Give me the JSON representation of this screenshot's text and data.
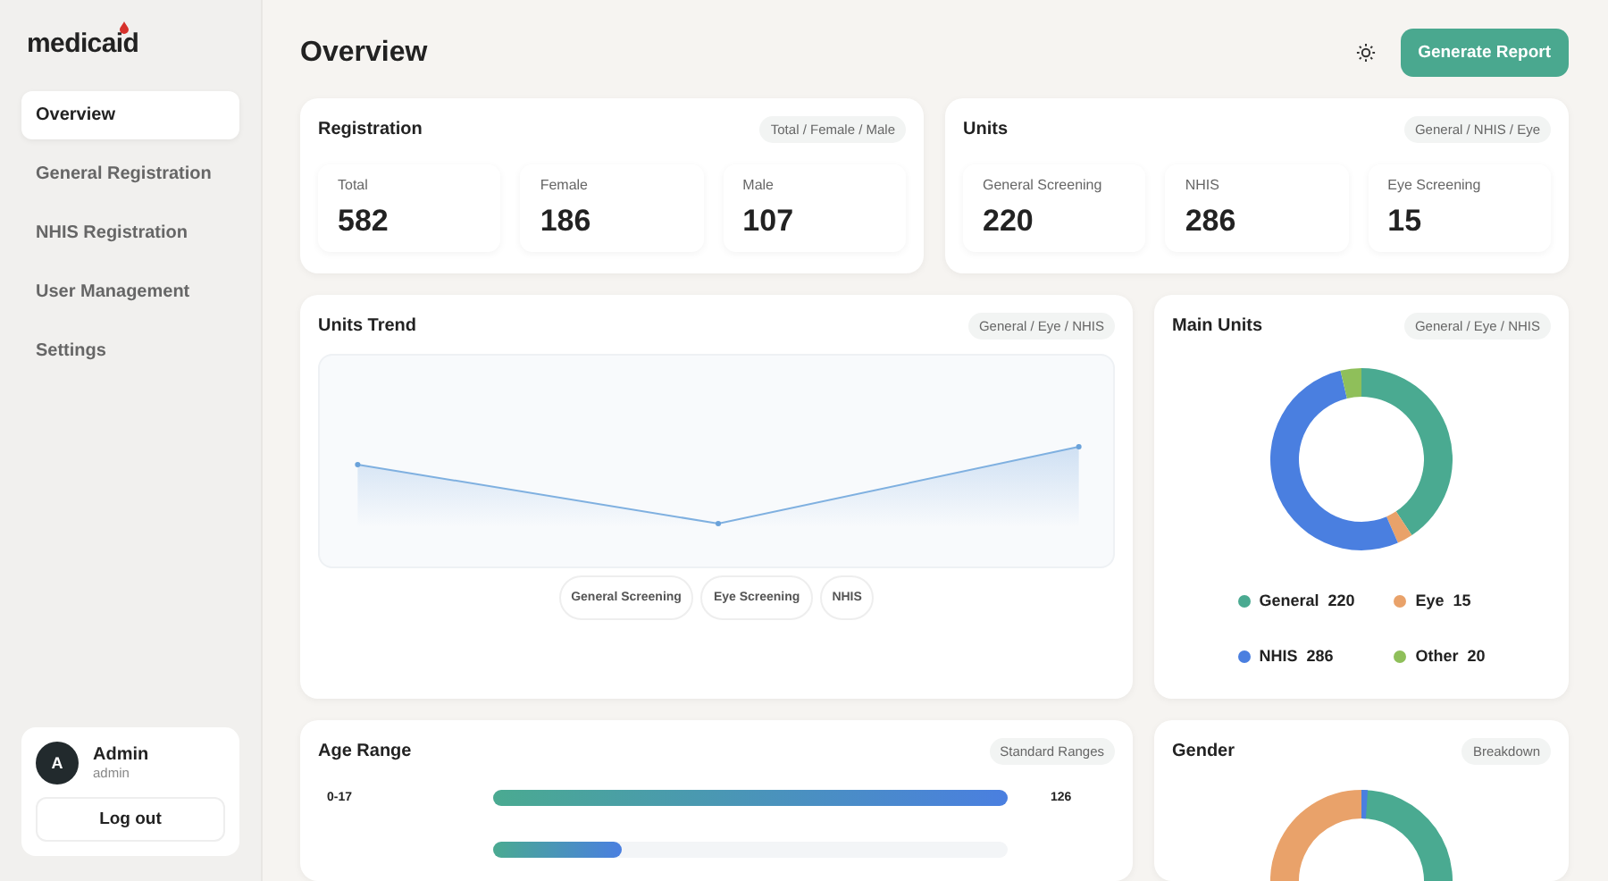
{
  "sidebar": {
    "logo": "medicaid",
    "items": [
      {
        "label": "Overview",
        "selected": true
      },
      {
        "label": "General Registration",
        "selected": false
      },
      {
        "label": "NHIS Registration",
        "selected": false
      },
      {
        "label": "User Management",
        "selected": false
      },
      {
        "label": "Settings",
        "selected": false
      }
    ],
    "user": {
      "initial": "A",
      "name": "Admin",
      "role": "admin",
      "logout": "Log out"
    }
  },
  "header": {
    "title": "Overview",
    "button": "Generate Report"
  },
  "stat_cards": [
    {
      "title": "Registration",
      "tag": "Total / Female / Male",
      "stats": [
        {
          "label": "Total",
          "value": "582"
        },
        {
          "label": "Female",
          "value": "186"
        },
        {
          "label": "Male",
          "value": "107"
        }
      ]
    },
    {
      "title": "Units",
      "tag": "General / NHIS / Eye",
      "stats": [
        {
          "label": "General Screening",
          "value": "220"
        },
        {
          "label": "NHIS",
          "value": "286"
        },
        {
          "label": "Eye Screening",
          "value": "15"
        }
      ]
    }
  ],
  "units_trend": {
    "title": "Units Trend",
    "tag": "General / Eye / NHIS",
    "legend": [
      "General Screening",
      "Eye Screening",
      "NHIS"
    ]
  },
  "main_units": {
    "title": "Main Units",
    "tag": "General / Eye / NHIS",
    "chart_data": {
      "type": "donut",
      "categories": [
        "General",
        "Eye",
        "NHIS",
        "Other"
      ],
      "series": [
        {
          "values": [
            40.67,
            2.77,
            52.86,
            3.7
          ]
        }
      ]
    },
    "legend": [
      {
        "value": "220",
        "color": "#4aaa91"
      },
      {
        "value": "15",
        "color": "#e9a26a"
      },
      {
        "value": "286",
        "color": "#4a7fe0"
      },
      {
        "value": "20",
        "color": "#8fbf5a"
      }
    ]
  },
  "age_range": {
    "title": "Age Range",
    "tag": "Standard Ranges",
    "rows": [
      {
        "label": "0-17",
        "value": "126",
        "level": 1.0
      },
      {
        "level": 0.25
      }
    ]
  },
  "gender": {
    "title": "Gender",
    "tag": "Breakdown"
  }
}
